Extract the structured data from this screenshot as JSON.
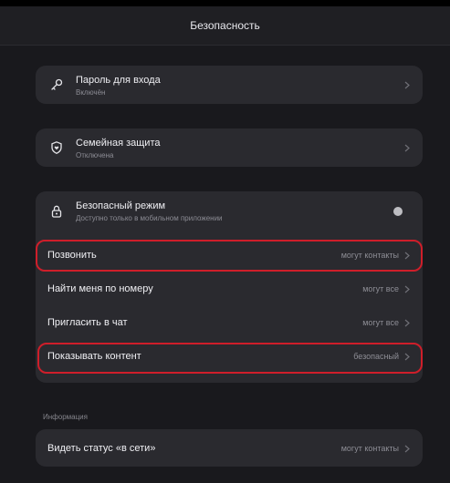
{
  "header": {
    "title": "Безопасность"
  },
  "login_password": {
    "title": "Пароль для входа",
    "subtitle": "Включён"
  },
  "family_protection": {
    "title": "Семейная защита",
    "subtitle": "Отключена"
  },
  "safe_mode": {
    "title": "Безопасный режим",
    "subtitle": "Доступно только в мобильном приложении",
    "enabled": false
  },
  "privacy_rows": [
    {
      "label": "Позвонить",
      "value": "могут контакты",
      "highlighted": true
    },
    {
      "label": "Найти меня по номеру",
      "value": "могут все",
      "highlighted": false
    },
    {
      "label": "Пригласить в чат",
      "value": "могут все",
      "highlighted": false
    },
    {
      "label": "Показывать контент",
      "value": "безопасный",
      "highlighted": true
    }
  ],
  "info_section": {
    "label": "Информация",
    "rows": [
      {
        "label": "Видеть статус «в сети»",
        "value": "могут контакты"
      }
    ]
  },
  "colors": {
    "background": "#19191d",
    "card": "#2a2a2f",
    "highlight": "#cf1e2a"
  },
  "icons": [
    "key-icon",
    "shield-heart-icon",
    "lock-icon",
    "chevron-right-icon"
  ]
}
